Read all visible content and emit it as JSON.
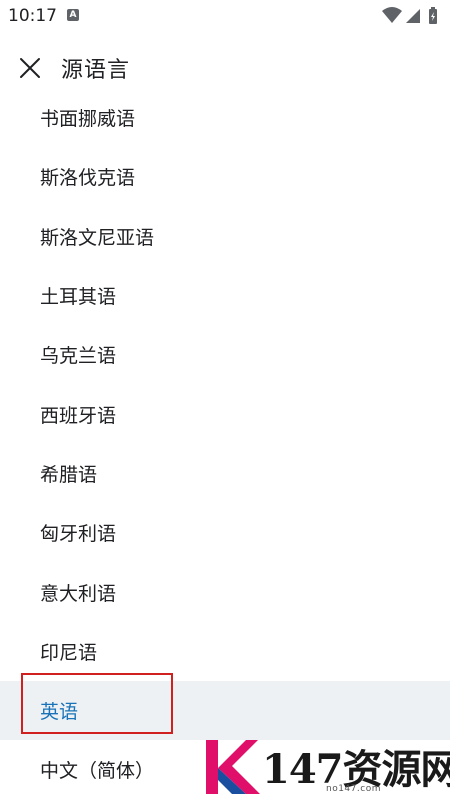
{
  "status_bar": {
    "time": "10:17",
    "app_icon": "A"
  },
  "header": {
    "title": "源语言",
    "close_icon": "close-icon"
  },
  "languages": [
    {
      "label": "书面挪威语",
      "selected": false
    },
    {
      "label": "斯洛伐克语",
      "selected": false
    },
    {
      "label": "斯洛文尼亚语",
      "selected": false
    },
    {
      "label": "土耳其语",
      "selected": false
    },
    {
      "label": "乌克兰语",
      "selected": false
    },
    {
      "label": "西班牙语",
      "selected": false
    },
    {
      "label": "希腊语",
      "selected": false
    },
    {
      "label": "匈牙利语",
      "selected": false
    },
    {
      "label": "意大利语",
      "selected": false
    },
    {
      "label": "印尼语",
      "selected": false
    },
    {
      "label": "英语",
      "selected": true
    },
    {
      "label": "中文（简体）",
      "selected": false
    }
  ],
  "watermark": {
    "text": "147资源网",
    "url": "no147.com"
  },
  "colors": {
    "selected_text": "#1a73b8",
    "selected_bg": "#eef1f4",
    "highlight_border": "#d0201f"
  }
}
